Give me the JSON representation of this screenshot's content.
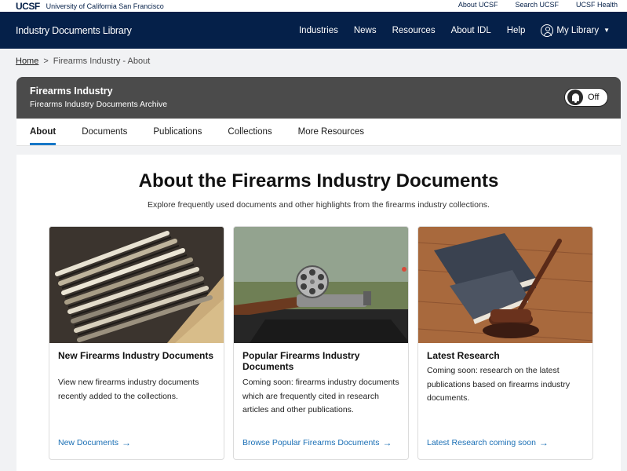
{
  "ucsf_bar": {
    "logo": "UCSF",
    "name": "University of California San Francisco",
    "links": [
      "About UCSF",
      "Search UCSF",
      "UCSF Health"
    ]
  },
  "nav": {
    "title": "Industry Documents Library",
    "links": [
      "Industries",
      "News",
      "Resources",
      "About IDL",
      "Help"
    ],
    "user_menu": "My Library"
  },
  "breadcrumb": {
    "home": "Home",
    "separator": ">",
    "current": "Firearms Industry - About"
  },
  "collection": {
    "title": "Firearms Industry",
    "subtitle": "Firearms Industry Documents Archive",
    "toggle_label": "Off"
  },
  "tabs": [
    "About",
    "Documents",
    "Publications",
    "Collections",
    "More Resources"
  ],
  "main": {
    "title": "About the Firearms Industry Documents",
    "subtitle": "Explore frequently used documents and other highlights from the firearms industry collections."
  },
  "cards": [
    {
      "title": "New Firearms Industry Documents",
      "body": "View new firearms industry documents recently added to the collections.",
      "link": "New Documents",
      "image_icon": "file-folders-image"
    },
    {
      "title": "Popular Firearms Industry Documents",
      "body": "Coming soon: firearms industry documents which are frequently cited in research articles and other publications.",
      "link": "Browse Popular Firearms Documents",
      "image_icon": "revolver-image"
    },
    {
      "title": "Latest Research",
      "body": "Coming soon: research on the latest publications based on firearms industry documents.",
      "link": "Latest Research coming soon",
      "image_icon": "books-gavel-image"
    }
  ],
  "colors": {
    "navy": "#052049",
    "header_gray": "#4b4b4b",
    "link_blue": "#1a6fb5",
    "tab_accent": "#1677c7"
  }
}
